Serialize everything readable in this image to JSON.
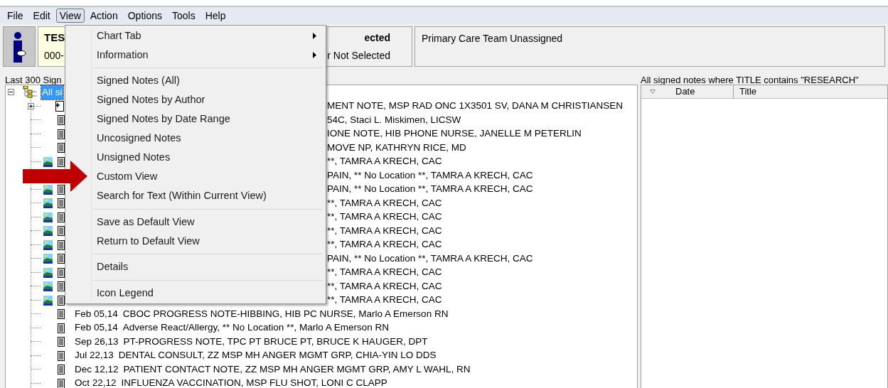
{
  "menu_bar": [
    {
      "label": "File",
      "selected": false
    },
    {
      "label": "Edit",
      "selected": false
    },
    {
      "label": "View",
      "selected": true
    },
    {
      "label": "Action",
      "selected": false
    },
    {
      "label": "Options",
      "selected": false
    },
    {
      "label": "Tools",
      "selected": false
    },
    {
      "label": "Help",
      "selected": false
    }
  ],
  "patient": {
    "name": "TES",
    "id": "000-"
  },
  "provider": {
    "title": "ected",
    "subtitle": "r Not Selected"
  },
  "care_team": {
    "text": "Primary Care Team Unassigned"
  },
  "notes_tree": {
    "label": "Last 300 Sign",
    "root": {
      "label": "All si",
      "selected": true,
      "expanded": true
    },
    "rows": [
      {
        "kind": "group",
        "tail": "MENT NOTE, MSP RAD ONC 1X3501 SV, DANA M CHRISTIANSEN"
      },
      {
        "kind": "note",
        "tail": "54C, Staci L. Miskimen, LICSW"
      },
      {
        "kind": "note",
        "tail": "IONE NOTE, HIB PHONE NURSE, JANELLE M PETERLIN"
      },
      {
        "kind": "note",
        "tail": "MOVE NP, KATHRYN RICE, MD"
      },
      {
        "kind": "image",
        "tail": "**, TAMRA A KRECH, CAC"
      },
      {
        "kind": "covered",
        "tail": "PAIN, ** No Location **, TAMRA A KRECH, CAC"
      },
      {
        "kind": "image",
        "tail": "PAIN, ** No Location **, TAMRA A KRECH, CAC"
      },
      {
        "kind": "image",
        "tail": "**, TAMRA A KRECH, CAC"
      },
      {
        "kind": "image",
        "tail": "**, TAMRA A KRECH, CAC"
      },
      {
        "kind": "image",
        "tail": "**, TAMRA A KRECH, CAC"
      },
      {
        "kind": "image",
        "tail": "**, TAMRA A KRECH, CAC"
      },
      {
        "kind": "image",
        "tail": "PAIN, ** No Location **, TAMRA A KRECH, CAC"
      },
      {
        "kind": "image",
        "tail": "**, TAMRA A KRECH, CAC"
      },
      {
        "kind": "image",
        "tail": "**, TAMRA A KRECH, CAC"
      },
      {
        "kind": "image",
        "tail": "**, TAMRA A KRECH, CAC"
      },
      {
        "kind": "note",
        "date": "Feb 05,14",
        "title": "CBOC PROGRESS NOTE-HIBBING, HIB PC NURSE, Marlo A Emerson RN"
      },
      {
        "kind": "note",
        "date": "Feb 05,14",
        "title": "Adverse React/Allergy, ** No Location **, Marlo A Emerson RN"
      },
      {
        "kind": "note",
        "date": "Sep 26,13",
        "title": "PT-PROGRESS NOTE, TPC PT BRUCE PT, BRUCE K HAUGER, DPT"
      },
      {
        "kind": "note",
        "date": "Jul 22,13",
        "title": "DENTAL CONSULT, ZZ MSP MH ANGER MGMT GRP, CHIA-YIN LO DDS"
      },
      {
        "kind": "note",
        "date": "Dec 12,12",
        "title": "PATIENT CONTACT NOTE, ZZ MSP MH ANGER MGMT GRP, AMY L WAHL, RN"
      },
      {
        "kind": "note",
        "date": "Oct 22,12",
        "title": "INFLUENZA VACCINATION, MSP FLU SHOT, LONI C CLAPP"
      }
    ]
  },
  "search_results": {
    "label": "All signed notes where TITLE contains \"RESEARCH\"",
    "columns": [
      "Date",
      "Title"
    ]
  },
  "view_menu": [
    {
      "kind": "item",
      "label": "Chart Tab",
      "submenu": true
    },
    {
      "kind": "item",
      "label": "Information",
      "submenu": true
    },
    {
      "kind": "separator"
    },
    {
      "kind": "item",
      "label": "Signed Notes (All)",
      "submenu": false
    },
    {
      "kind": "item",
      "label": "Signed Notes by Author",
      "submenu": false
    },
    {
      "kind": "item",
      "label": "Signed Notes by Date Range",
      "submenu": false
    },
    {
      "kind": "item",
      "label": "Uncosigned Notes",
      "submenu": false
    },
    {
      "kind": "item",
      "label": "Unsigned Notes",
      "submenu": false
    },
    {
      "kind": "item",
      "label": "Custom View",
      "submenu": false
    },
    {
      "kind": "item",
      "label": "Search for Text (Within Current View)",
      "submenu": false
    },
    {
      "kind": "separator"
    },
    {
      "kind": "item",
      "label": "Save as Default View",
      "submenu": false
    },
    {
      "kind": "item",
      "label": "Return to Default View",
      "submenu": false
    },
    {
      "kind": "separator"
    },
    {
      "kind": "item",
      "label": "Details",
      "submenu": false
    },
    {
      "kind": "separator"
    },
    {
      "kind": "item",
      "label": "Icon Legend",
      "submenu": false
    }
  ]
}
